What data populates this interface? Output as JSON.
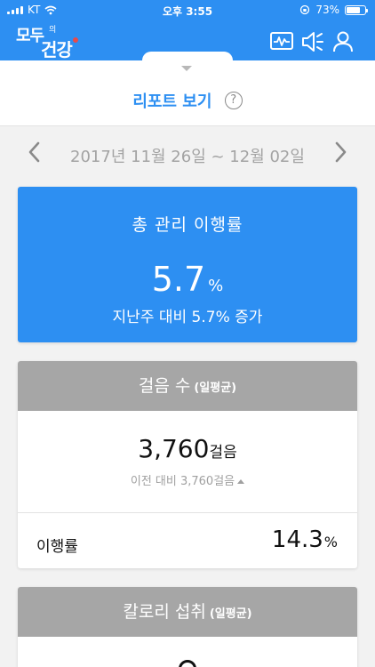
{
  "status_bar": {
    "carrier": "KT",
    "time": "오후 3:55",
    "battery": "73%",
    "battery_level": 0.73
  },
  "header": {
    "logo": {
      "part1": "모두",
      "part2": "의",
      "part3": "건강"
    },
    "icons": [
      "activity-monitor-icon",
      "speaker-icon",
      "user-icon"
    ],
    "accent_color": "#2d8ff2"
  },
  "report": {
    "title": "리포트 보기",
    "help_glyph": "?"
  },
  "date_nav": {
    "range": "2017년 11월 26일 ~ 12월 02일"
  },
  "total_card": {
    "title": "총 관리 이행률",
    "value": "5.7",
    "unit": "%",
    "comparison": "지난주 대비 5.7% 증가"
  },
  "steps_card": {
    "title": "걸음 수",
    "subtitle": "(일평균)",
    "value": "3,760",
    "unit": "걸음",
    "previous": "이전 대비 3,760걸음",
    "rate_label": "이행률",
    "rate_value": "14.3",
    "rate_unit": "%"
  },
  "calorie_card": {
    "title": "칼로리 섭취",
    "subtitle": "(일평균)"
  }
}
